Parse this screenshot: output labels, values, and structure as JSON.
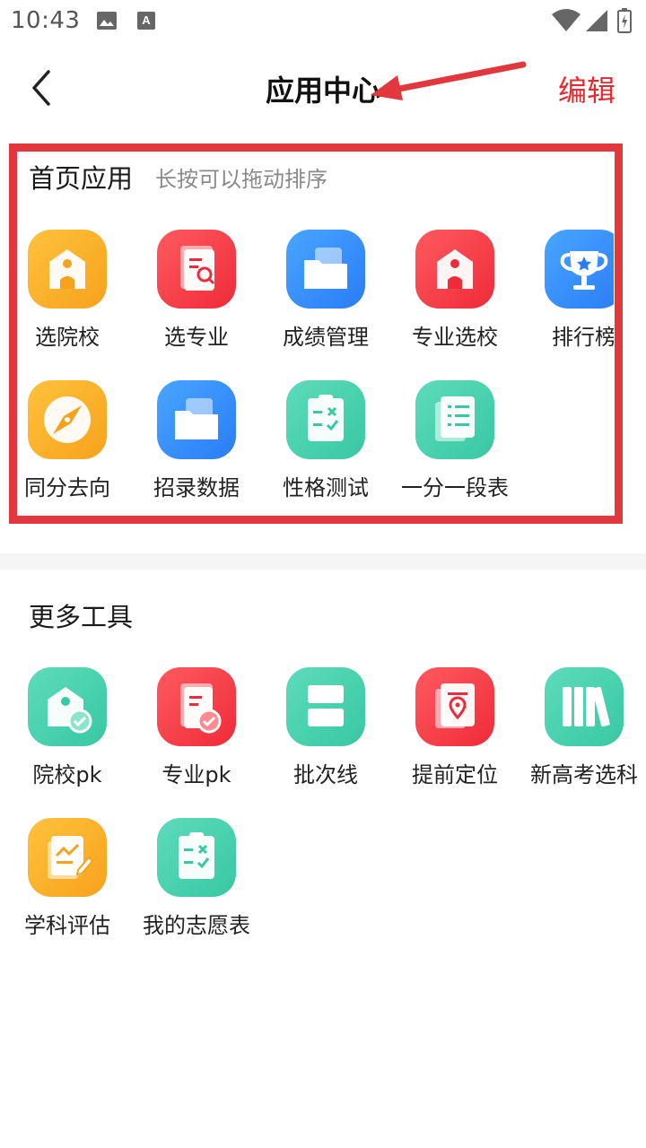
{
  "status_bar": {
    "time": "10:43",
    "icons": [
      "image-icon",
      "a-notification-icon",
      "wifi-icon",
      "signal-icon",
      "battery-charging-icon"
    ]
  },
  "header": {
    "title": "应用中心",
    "edit_label": "编辑",
    "back_icon": "chevron-left-icon"
  },
  "home_apps": {
    "heading": "首页应用",
    "hint": "长按可以拖动排序",
    "items": [
      {
        "label": "选院校",
        "icon": "school-icon",
        "color": "#f7a21b"
      },
      {
        "label": "选专业",
        "icon": "major-search-icon",
        "color": "#ef2b39"
      },
      {
        "label": "成绩管理",
        "icon": "folder-icon",
        "color": "#2a7cf6"
      },
      {
        "label": "专业选校",
        "icon": "school-icon",
        "color": "#ef2b39"
      },
      {
        "label": "排行榜",
        "icon": "trophy-icon",
        "color": "#2a7cf6"
      },
      {
        "label": "同分去向",
        "icon": "compass-icon",
        "color": "#f7a21b"
      },
      {
        "label": "招录数据",
        "icon": "folder-icon",
        "color": "#2a7cf6"
      },
      {
        "label": "性格测试",
        "icon": "clipboard-icon",
        "color": "#38c8a3"
      },
      {
        "label": "一分一段表",
        "icon": "document-list-icon",
        "color": "#38c8a3"
      }
    ]
  },
  "more_tools": {
    "heading": "更多工具",
    "items": [
      {
        "label": "院校pk",
        "icon": "school-check-icon",
        "color": "#38c8a3"
      },
      {
        "label": "专业pk",
        "icon": "major-check-icon",
        "color": "#ef2b39"
      },
      {
        "label": "批次线",
        "icon": "batch-line-icon",
        "color": "#38c8a3"
      },
      {
        "label": "提前定位",
        "icon": "location-doc-icon",
        "color": "#ef2b39"
      },
      {
        "label": "新高考选科",
        "icon": "books-icon",
        "color": "#38c8a3"
      },
      {
        "label": "学科评估",
        "icon": "chart-edit-icon",
        "color": "#f7a21b"
      },
      {
        "label": "我的志愿表",
        "icon": "clipboard-icon",
        "color": "#38c8a3"
      }
    ]
  }
}
